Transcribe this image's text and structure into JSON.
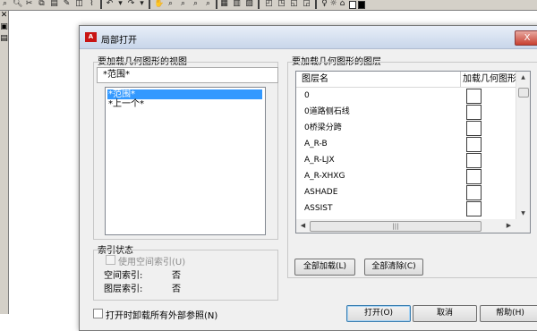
{
  "toolbar": {
    "icons": [
      "open-icon",
      "zoom-icon",
      "cut-icon",
      "copy-icon",
      "paste-icon",
      "match-properties-icon",
      "undo-icon",
      "redo-icon",
      "pan-icon",
      "zoom-realtime-icon",
      "zoom-window-icon",
      "zoom-previous-icon",
      "zoom-extents-icon",
      "properties-icon",
      "design-center-icon",
      "layer-manager-icon",
      "layer-state-icon",
      "layer-previous-icon",
      "layer-isolate-icon",
      "sun-icon",
      "lightbulb-icon",
      "color-swatch-icon"
    ]
  },
  "dialog": {
    "title": "局部打开",
    "close_label": "X",
    "views_section": {
      "label": "要加载几何图形的视图",
      "current_view": "*范围*",
      "items": [
        "*范围*",
        "*上一个*"
      ]
    },
    "index_section": {
      "label": "索引状态",
      "spatial_index_checkbox": "使用空间索引(U)",
      "spatial_index_label": "空间索引:",
      "spatial_index_value": "否",
      "layer_index_label": "图层索引:",
      "layer_index_value": "否"
    },
    "layers_section": {
      "label": "要加载几何图形的图层",
      "col_name": "图层名",
      "col_load": "加载几何图形",
      "layers": [
        "0",
        "0道路侧石线",
        "0桥梁分跨",
        "A_R-B",
        "A_R-LJX",
        "A_R-XHXG",
        "ASHADE",
        "ASSIST"
      ]
    },
    "buttons": {
      "load_all": "全部加载(L)",
      "clear_all": "全部清除(C)",
      "open": "打开(O)",
      "cancel": "取消",
      "help": "帮助(H)"
    },
    "unload_xrefs_checkbox": "打开时卸载所有外部参照(N)"
  },
  "colors": {
    "selection": "#3399ff",
    "close_button": "#c84030",
    "dialog_bg": "#f0f0f0"
  }
}
